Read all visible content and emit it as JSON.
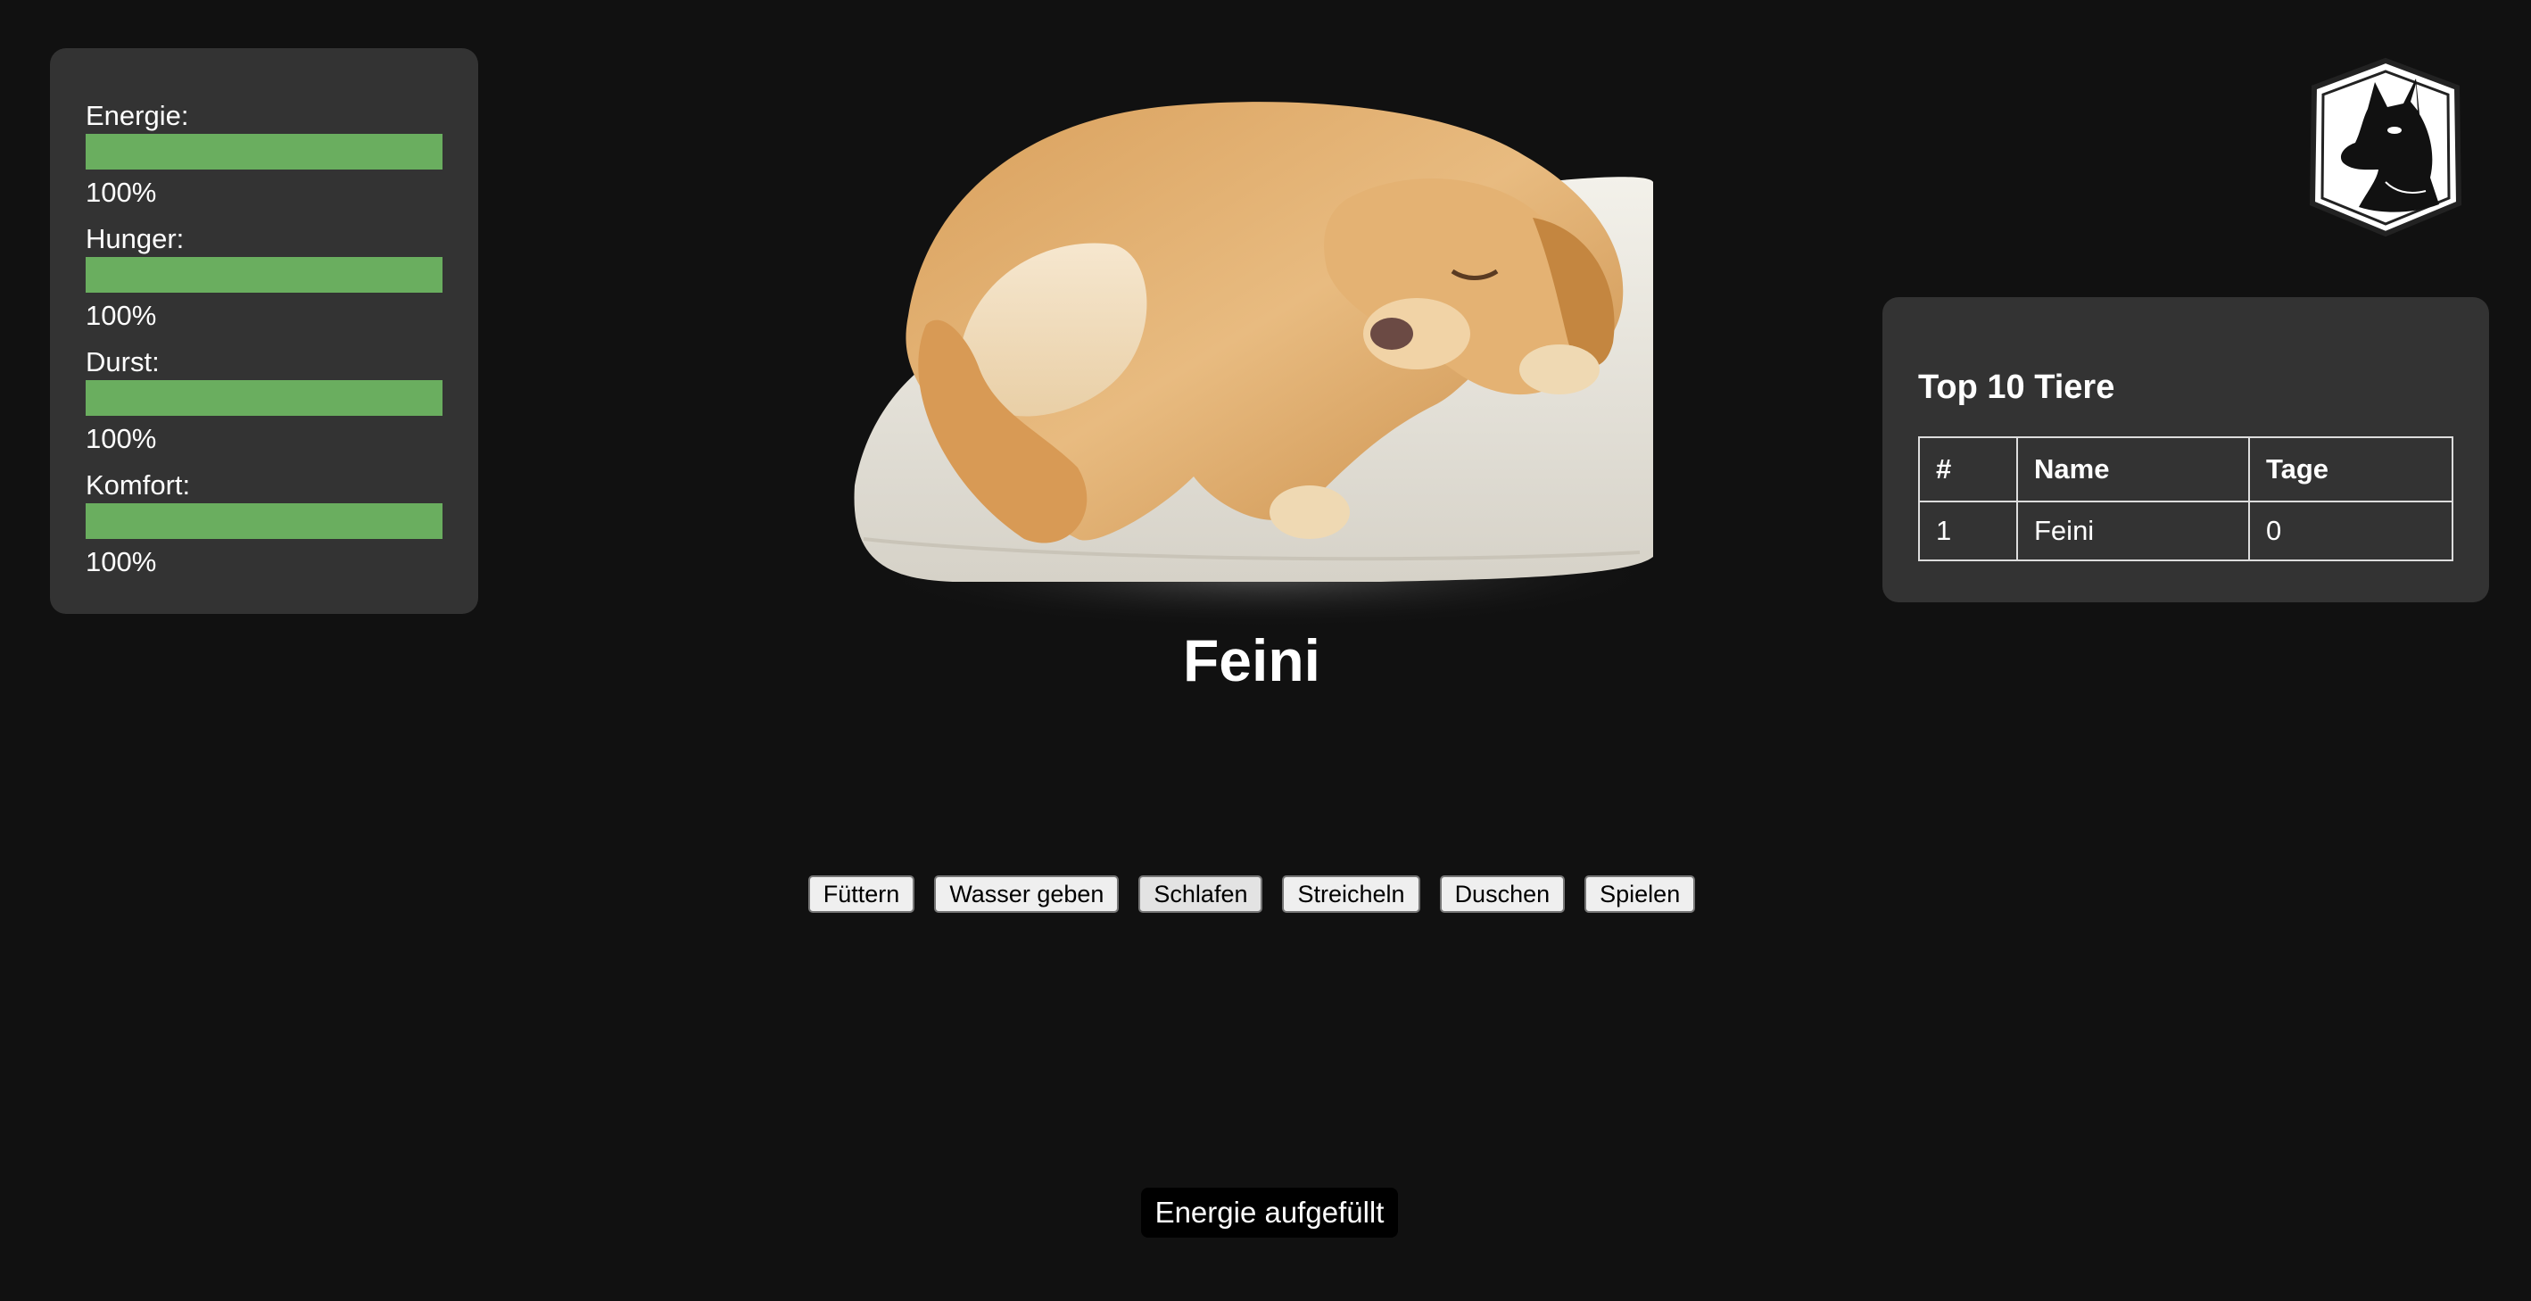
{
  "stats": [
    {
      "label": "Energie:",
      "value_text": "100%",
      "fill": 1.0
    },
    {
      "label": "Hunger:",
      "value_text": "100%",
      "fill": 1.0
    },
    {
      "label": "Durst:",
      "value_text": "100%",
      "fill": 1.0
    },
    {
      "label": "Komfort:",
      "value_text": "100%",
      "fill": 1.0
    }
  ],
  "pet": {
    "name": "Feini",
    "image": "sleeping-golden-retriever-on-pillow"
  },
  "actions": [
    {
      "label": "Füttern",
      "name": "feed-button"
    },
    {
      "label": "Wasser geben",
      "name": "give-water-button"
    },
    {
      "label": "Schlafen",
      "name": "sleep-button"
    },
    {
      "label": "Streicheln",
      "name": "pet-button"
    },
    {
      "label": "Duschen",
      "name": "shower-button"
    },
    {
      "label": "Spielen",
      "name": "play-button"
    }
  ],
  "logo": {
    "icon": "dog-head-shield-icon"
  },
  "leaderboard": {
    "title": "Top 10 Tiere",
    "columns": [
      "#",
      "Name",
      "Tage"
    ],
    "rows": [
      [
        "1",
        "Feini",
        "0"
      ]
    ]
  },
  "toast": {
    "text": "Energie aufgefüllt"
  },
  "colors": {
    "background": "#111111",
    "panel": "#333333",
    "bar_fill": "#6aae5f"
  }
}
